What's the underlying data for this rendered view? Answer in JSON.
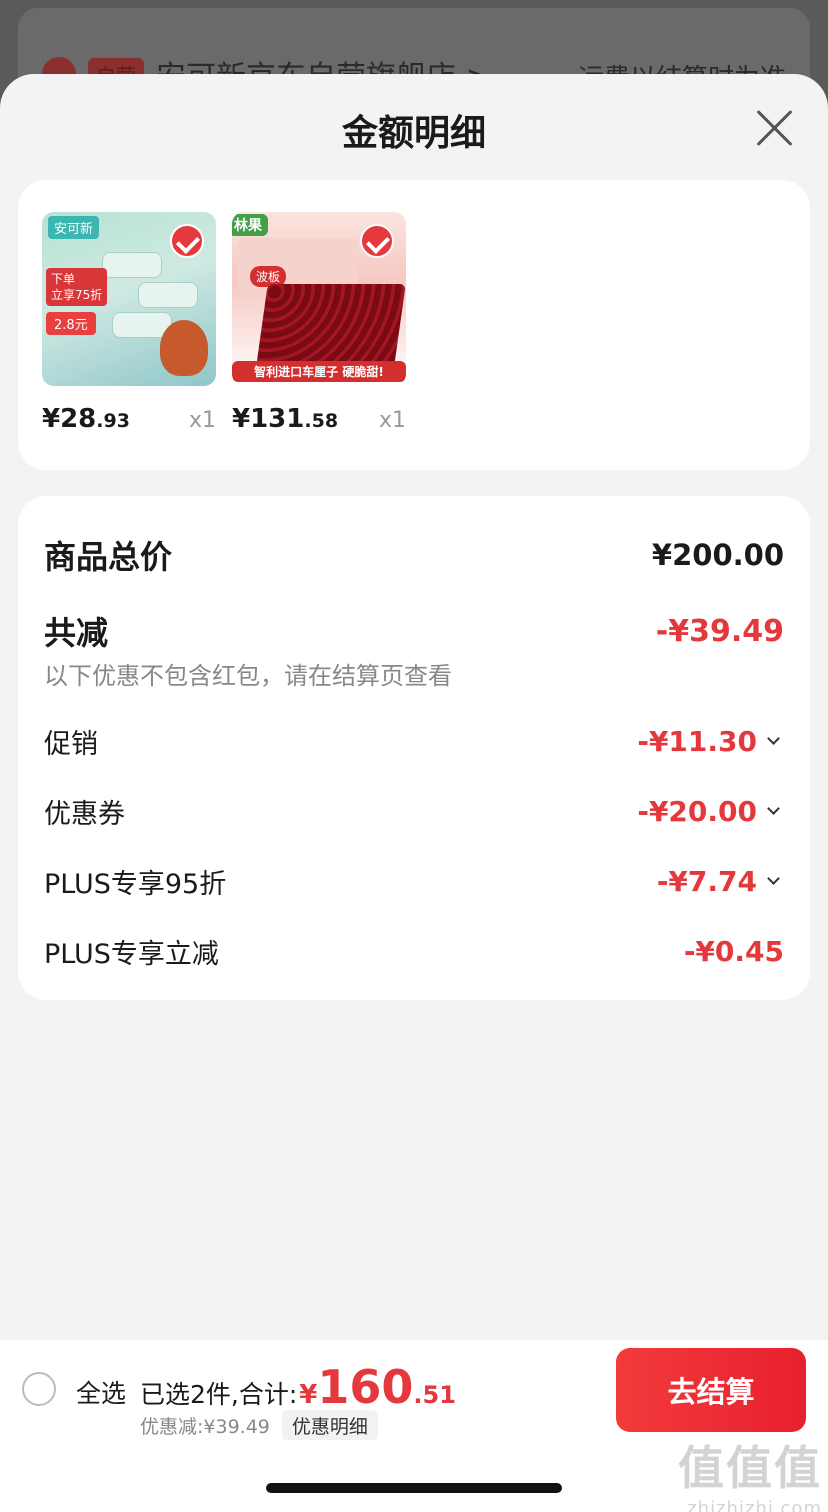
{
  "background": {
    "badge": "自营",
    "store_name": "安可新京东自营旗舰店 >",
    "shipping_note": "运费以结算时为准"
  },
  "sheet": {
    "title": "金额明细"
  },
  "products": [
    {
      "brand": "安可新",
      "promo": "下单\n立享75折",
      "promo_price": "2.8元",
      "price_int": "¥28",
      "price_dec": ".93",
      "qty": "x1"
    },
    {
      "brand": "林果",
      "lid_label": "波板",
      "banner": "智利进口车厘子 硬脆甜!",
      "price_int": "¥131",
      "price_dec": ".58",
      "qty": "x1"
    }
  ],
  "breakdown": {
    "total_label": "商品总价",
    "total_value": "¥200.00",
    "reduce_label": "共减",
    "reduce_value": "-¥39.49",
    "note": "以下优惠不包含红包，请在结算页查看",
    "items": [
      {
        "label": "促销",
        "value": "-¥11.30"
      },
      {
        "label": "优惠券",
        "value": "-¥20.00"
      },
      {
        "label": "PLUS专享95折",
        "value": "-¥7.74"
      },
      {
        "label": "PLUS专享立减",
        "value": "-¥0.45"
      }
    ]
  },
  "bottom_bar": {
    "select_all": "全选",
    "selected_text": "已选2件,合计:",
    "currency": "¥",
    "total_int": "160",
    "total_dec": ".51",
    "discount_text": "优惠减:¥39.49",
    "detail_label": "优惠明细",
    "checkout_label": "去结算"
  },
  "watermark": {
    "logo": "值值值",
    "url": "zhizhizhi.com"
  },
  "colors": {
    "accent_red": "#e4393c",
    "checkout_gradient": "#f23b3b"
  }
}
